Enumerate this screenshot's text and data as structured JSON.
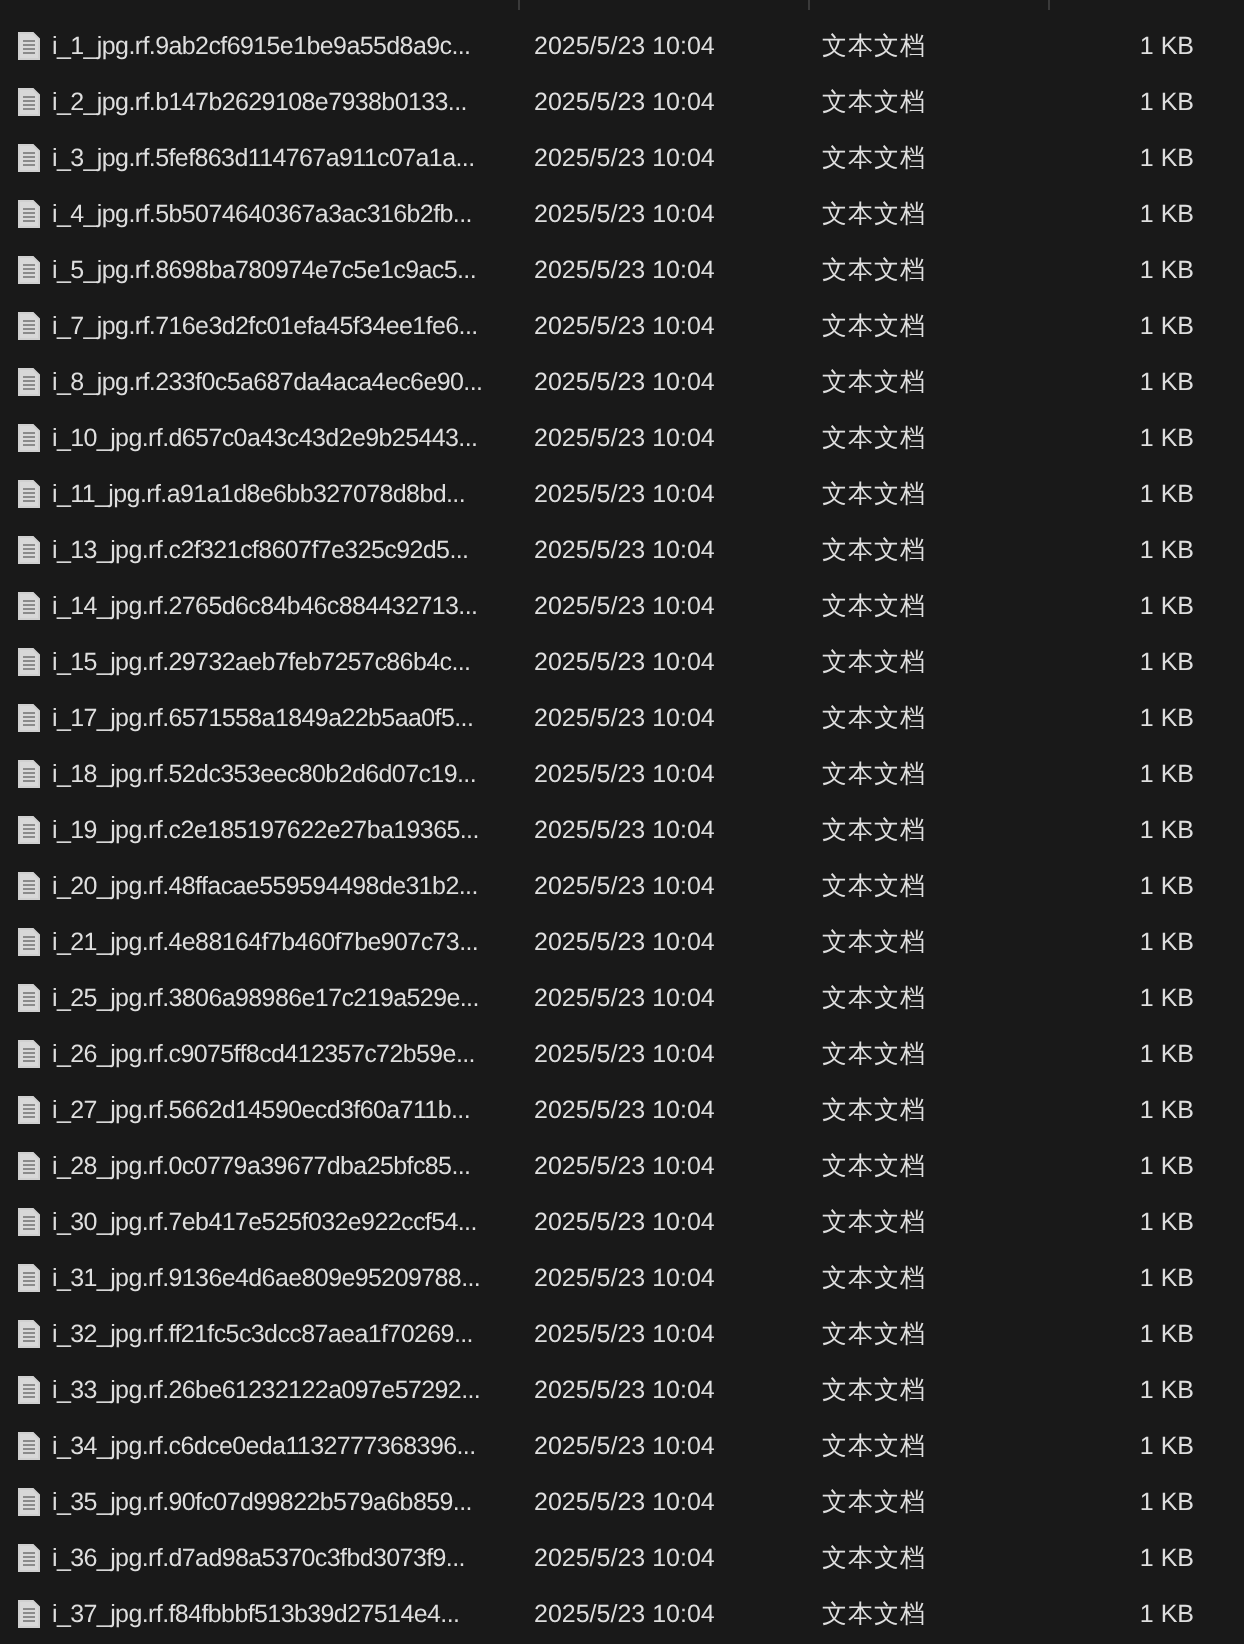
{
  "files": [
    {
      "name": "i_1_jpg.rf.9ab2cf6915e1be9a55d8a9c...",
      "modified": "2025/5/23 10:04",
      "type": "文本文档",
      "size": "1 KB"
    },
    {
      "name": "i_2_jpg.rf.b147b2629108e7938b0133...",
      "modified": "2025/5/23 10:04",
      "type": "文本文档",
      "size": "1 KB"
    },
    {
      "name": "i_3_jpg.rf.5fef863d114767a911c07a1a...",
      "modified": "2025/5/23 10:04",
      "type": "文本文档",
      "size": "1 KB"
    },
    {
      "name": "i_4_jpg.rf.5b5074640367a3ac316b2fb...",
      "modified": "2025/5/23 10:04",
      "type": "文本文档",
      "size": "1 KB"
    },
    {
      "name": "i_5_jpg.rf.8698ba780974e7c5e1c9ac5...",
      "modified": "2025/5/23 10:04",
      "type": "文本文档",
      "size": "1 KB"
    },
    {
      "name": "i_7_jpg.rf.716e3d2fc01efa45f34ee1fe6...",
      "modified": "2025/5/23 10:04",
      "type": "文本文档",
      "size": "1 KB"
    },
    {
      "name": "i_8_jpg.rf.233f0c5a687da4aca4ec6e90...",
      "modified": "2025/5/23 10:04",
      "type": "文本文档",
      "size": "1 KB"
    },
    {
      "name": "i_10_jpg.rf.d657c0a43c43d2e9b25443...",
      "modified": "2025/5/23 10:04",
      "type": "文本文档",
      "size": "1 KB"
    },
    {
      "name": "i_11_jpg.rf.a91a1d8e6bb327078d8bd...",
      "modified": "2025/5/23 10:04",
      "type": "文本文档",
      "size": "1 KB"
    },
    {
      "name": "i_13_jpg.rf.c2f321cf8607f7e325c92d5...",
      "modified": "2025/5/23 10:04",
      "type": "文本文档",
      "size": "1 KB"
    },
    {
      "name": "i_14_jpg.rf.2765d6c84b46c884432713...",
      "modified": "2025/5/23 10:04",
      "type": "文本文档",
      "size": "1 KB"
    },
    {
      "name": "i_15_jpg.rf.29732aeb7feb7257c86b4c...",
      "modified": "2025/5/23 10:04",
      "type": "文本文档",
      "size": "1 KB"
    },
    {
      "name": "i_17_jpg.rf.6571558a1849a22b5aa0f5...",
      "modified": "2025/5/23 10:04",
      "type": "文本文档",
      "size": "1 KB"
    },
    {
      "name": "i_18_jpg.rf.52dc353eec80b2d6d07c19...",
      "modified": "2025/5/23 10:04",
      "type": "文本文档",
      "size": "1 KB"
    },
    {
      "name": "i_19_jpg.rf.c2e185197622e27ba19365...",
      "modified": "2025/5/23 10:04",
      "type": "文本文档",
      "size": "1 KB"
    },
    {
      "name": "i_20_jpg.rf.48ffacae559594498de31b2...",
      "modified": "2025/5/23 10:04",
      "type": "文本文档",
      "size": "1 KB"
    },
    {
      "name": "i_21_jpg.rf.4e88164f7b460f7be907c73...",
      "modified": "2025/5/23 10:04",
      "type": "文本文档",
      "size": "1 KB"
    },
    {
      "name": "i_25_jpg.rf.3806a98986e17c219a529e...",
      "modified": "2025/5/23 10:04",
      "type": "文本文档",
      "size": "1 KB"
    },
    {
      "name": "i_26_jpg.rf.c9075ff8cd412357c72b59e...",
      "modified": "2025/5/23 10:04",
      "type": "文本文档",
      "size": "1 KB"
    },
    {
      "name": "i_27_jpg.rf.5662d14590ecd3f60a711b...",
      "modified": "2025/5/23 10:04",
      "type": "文本文档",
      "size": "1 KB"
    },
    {
      "name": "i_28_jpg.rf.0c0779a39677dba25bfc85...",
      "modified": "2025/5/23 10:04",
      "type": "文本文档",
      "size": "1 KB"
    },
    {
      "name": "i_30_jpg.rf.7eb417e525f032e922ccf54...",
      "modified": "2025/5/23 10:04",
      "type": "文本文档",
      "size": "1 KB"
    },
    {
      "name": "i_31_jpg.rf.9136e4d6ae809e95209788...",
      "modified": "2025/5/23 10:04",
      "type": "文本文档",
      "size": "1 KB"
    },
    {
      "name": "i_32_jpg.rf.ff21fc5c3dcc87aea1f70269...",
      "modified": "2025/5/23 10:04",
      "type": "文本文档",
      "size": "1 KB"
    },
    {
      "name": "i_33_jpg.rf.26be61232122a097e57292...",
      "modified": "2025/5/23 10:04",
      "type": "文本文档",
      "size": "1 KB"
    },
    {
      "name": "i_34_jpg.rf.c6dce0eda1132777368396...",
      "modified": "2025/5/23 10:04",
      "type": "文本文档",
      "size": "1 KB"
    },
    {
      "name": "i_35_jpg.rf.90fc07d99822b579a6b859...",
      "modified": "2025/5/23 10:04",
      "type": "文本文档",
      "size": "1 KB"
    },
    {
      "name": "i_36_jpg.rf.d7ad98a5370c3fbd3073f9...",
      "modified": "2025/5/23 10:04",
      "type": "文本文档",
      "size": "1 KB"
    },
    {
      "name": "i_37_jpg.rf.f84fbbbf513b39d27514e4...",
      "modified": "2025/5/23 10:04",
      "type": "文本文档",
      "size": "1 KB"
    }
  ]
}
